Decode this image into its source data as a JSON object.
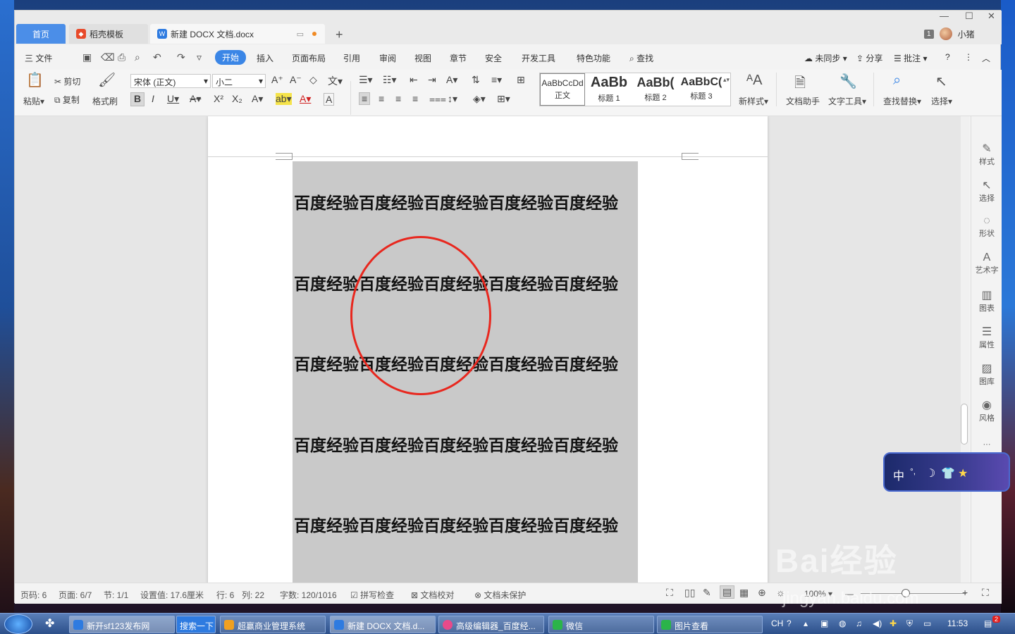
{
  "tabs": {
    "home": "首页",
    "template": "稻壳模板",
    "doc": "新建 DOCX 文档.docx",
    "add": "+"
  },
  "window": {
    "count_badge": "1",
    "username": "小猪"
  },
  "menu": {
    "file": "三 文件",
    "items": [
      "开始",
      "插入",
      "页面布局",
      "引用",
      "审阅",
      "视图",
      "章节",
      "安全",
      "开发工具",
      "特色功能"
    ],
    "find": "查找",
    "sync": "未同步",
    "share": "分享",
    "comment": "批注",
    "help": "?"
  },
  "ribbon": {
    "paste": "粘贴",
    "cut": "剪切",
    "copy": "复制",
    "format_painter": "格式刷",
    "font_name": "宋体 (正文)",
    "font_size": "小二",
    "styles": [
      {
        "preview": "AaBbCcDd",
        "label": "正文"
      },
      {
        "preview": "AaBb",
        "label": "标题 1"
      },
      {
        "preview": "AaBb(",
        "label": "标题 2"
      },
      {
        "preview": "AaBbC(",
        "label": "标题 3"
      }
    ],
    "new_style": "新样式",
    "doc_helper": "文档助手",
    "text_tools": "文字工具",
    "find_replace": "查找替换",
    "select": "选择"
  },
  "document": {
    "lines": [
      "百度经验百度经验百度经验百度经验百度经验",
      "百度经验百度经验百度经验百度经验百度经验",
      "百度经验百度经验百度经验百度经验百度经验",
      "百度经验百度经验百度经验百度经验百度经验",
      "百度经验百度经验百度经验百度经验百度经验"
    ]
  },
  "side_panel": [
    "样式",
    "选择",
    "形状",
    "艺术字",
    "图表",
    "属性",
    "图库",
    "风格"
  ],
  "status": {
    "page_code": "页码: 6",
    "page": "页面: 6/7",
    "section": "节: 1/1",
    "setting": "设置值: 17.6厘米",
    "row": "行: 6",
    "col": "列: 22",
    "words": "字数: 120/1016",
    "spell": "拼写检查",
    "proof": "文档校对",
    "protect": "文档未保护",
    "zoom": "100%"
  },
  "ime": {
    "mode": "中"
  },
  "taskbar": {
    "tasks": [
      "新开sf123发布网",
      "搜索一下",
      "超赢商业管理系统",
      "新建 DOCX 文档.d...",
      "高级编辑器_百度经...",
      "微信",
      "图片查看"
    ],
    "lang": "CH",
    "time": "11:53",
    "notify_count": "2"
  },
  "watermark": {
    "logo": "Bai经验",
    "url": "jingyan.baidu.com"
  },
  "colors": {
    "accent": "#3b86e6",
    "circle": "#e8271e",
    "highlight": "#c9c9c9"
  }
}
